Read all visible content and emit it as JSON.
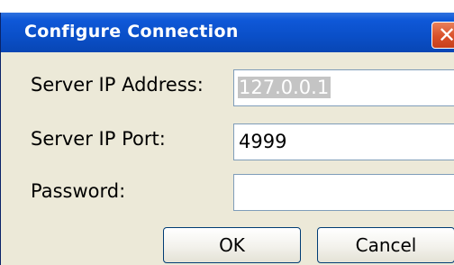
{
  "window": {
    "title": "Configure Connection",
    "close_glyph": "✕"
  },
  "form": {
    "server_ip_label": "Server IP Address:",
    "server_ip_value": "127.0.0.1",
    "server_port_label": "Server IP Port:",
    "server_port_value": "4999",
    "password_label": "Password:",
    "password_value": ""
  },
  "buttons": {
    "ok_label": "OK",
    "cancel_label": "Cancel"
  },
  "colors": {
    "titlebar": "#0a4fc8",
    "window_bg": "#ece9d8",
    "close_button": "#d9502a",
    "field_border": "#7f9db9"
  }
}
